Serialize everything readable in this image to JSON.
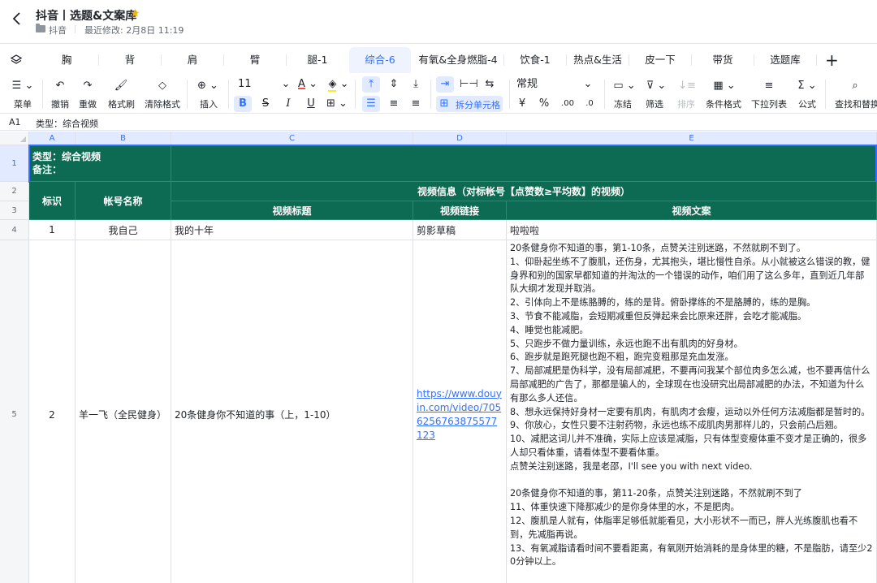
{
  "header": {
    "title": "抖音丨选题&文案库",
    "folder": "抖音",
    "last_modified": "最近修改: 2月8日 11:19"
  },
  "tabs": [
    "胸",
    "背",
    "肩",
    "臂",
    "腿-1",
    "综合-6",
    "有氧&全身燃脂-4",
    "饮食-1",
    "热点&生活",
    "皮一下",
    "带货",
    "选题库"
  ],
  "active_tab_index": 5,
  "toolbar": {
    "menu": "菜单",
    "undo": "撤销",
    "redo": "重做",
    "format_painter": "格式刷",
    "clear_format": "清除格式",
    "insert": "插入",
    "font_size": "11",
    "split_cell": "拆分单元格",
    "number_format": "常规",
    "currency": "¥",
    "percent": "%",
    "freeze": "冻结",
    "filter": "筛选",
    "sort": "排序",
    "cond_format": "条件格式",
    "dropdown_list": "下拉列表",
    "formula": "公式",
    "find_replace": "查找和替换"
  },
  "formula_bar": {
    "cell_ref": "A1",
    "content": "类型：综合视频"
  },
  "columns": [
    "A",
    "B",
    "C",
    "D",
    "E"
  ],
  "rows": [
    "1",
    "2",
    "3",
    "4",
    "5"
  ],
  "sheet": {
    "r1_type": "类型：综合视频",
    "r1_note": "备注：",
    "h_id": "标识",
    "h_account": "帐号名称",
    "h_video_info": "视频信息（对标帐号【点赞数≥平均数】的视频）",
    "h_title": "视频标题",
    "h_link": "视频链接",
    "h_copy": "视频文案",
    "r4": {
      "id": "1",
      "account": "我自己",
      "title": "我的十年",
      "link": "剪影草稿",
      "copy": "啦啦啦"
    },
    "r5": {
      "id": "2",
      "account": "羊一飞（全民健身）",
      "title": "20条健身你不知道的事（上，1-10）",
      "link": "https://www.douyin.com/video/7056256763875577123",
      "copy": "20条健身你不知道的事，第1-10条，点赞关注别迷路，不然就刷不到了。\n1、仰卧起坐练不了腹肌，还伤身，尤其抱头，堪比慢性自杀。从小就被这么错误的教，健身界和别的国家早都知道的并淘汰的一个错误的动作，咱们用了这么多年，直到近几年部队大纲才发现并取消。\n2、引体向上不是练胳膊的，练的是背。俯卧撑练的不是胳膊的，练的是胸。\n3、节食不能减脂，会短期减重但反弹起来会比原来还胖，会吃才能减脂。\n4、睡觉也能减肥。\n5、只跑步不做力量训练，永远也跑不出有肌肉的好身材。\n6、跑步就是跑死腿也跑不粗，跑完变粗那是充血发涨。\n7、局部减肥是伪科学，没有局部减肥，不要再问我某个部位肉多怎么减，也不要再信什么局部减肥的广告了，那都是骗人的，全球现在也没研究出局部减肥的办法，不知道为什么有那么多人还信。\n8、想永远保持好身材一定要有肌肉，有肌肉才会瘦，运动以外任何方法减脂都是暂时的。\n9、你放心，女性只要不注射药物，永远也练不成肌肉男那样儿的，只会前凸后翘。\n10、减肥这词儿并不准确，实际上应该是减脂，只有体型变瘦体重不变才是正确的，很多人却只看体重，请看体型不要看体重。\n点赞关注别迷路，我是老邵，I'll see you with next video.\n\n20条健身你不知道的事，第11-20条，点赞关注别迷路，不然就刷不到了\n11、体重快速下降那减少的是你身体里的水，不是肥肉。\n12、腹肌是人就有，体脂率足够低就能看见，大小形状不一而已，胖人光练腹肌也看不到，先减脂再说。\n13、有氧减脂请看时间不要看距离，有氧刚开始消耗的是身体里的糖，不是脂肪，请至少20分钟以上。"
    }
  }
}
